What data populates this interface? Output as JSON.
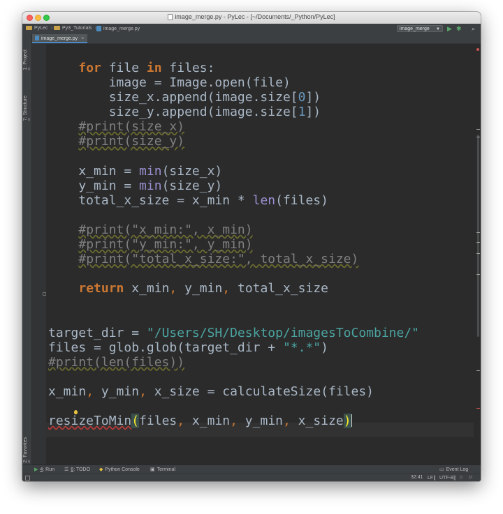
{
  "window": {
    "title": "image_merge.py - PyLec - [~/Documents/_Python/PyLec]"
  },
  "navbar": {
    "breadcrumbs": [
      "PyLec",
      "Py3_Tutorials",
      "image_merge.py"
    ],
    "run_config": "image_merge",
    "icons": [
      "run-icon",
      "debug-icon",
      "search-icon"
    ]
  },
  "tabs": [
    {
      "label": "image_merge.py",
      "active": true
    }
  ],
  "left_tool_windows": {
    "project": {
      "number": "1",
      "label": ": Project"
    },
    "structure": {
      "number": "7",
      "label": ": Structure"
    },
    "favorites": {
      "number": "2",
      "label": ": Favorites"
    }
  },
  "code_lines": [
    [
      {
        "t": "    "
      },
      {
        "t": "for",
        "c": "kw"
      },
      {
        "t": " file "
      },
      {
        "t": "in",
        "c": "kw"
      },
      {
        "t": " files:"
      }
    ],
    [
      {
        "t": "        image = Image.open(file)"
      }
    ],
    [
      {
        "t": "        size_x.append(image.size["
      },
      {
        "t": "0",
        "c": "num"
      },
      {
        "t": "])"
      }
    ],
    [
      {
        "t": "        size_y.append(image.size["
      },
      {
        "t": "1",
        "c": "num"
      },
      {
        "t": "])"
      }
    ],
    [
      {
        "t": "    "
      },
      {
        "t": "#print(size_x)",
        "c": "cm"
      }
    ],
    [
      {
        "t": "    "
      },
      {
        "t": "#print(size_y)",
        "c": "cm"
      }
    ],
    [],
    [
      {
        "t": "    x_min = "
      },
      {
        "t": "min",
        "c": "bi"
      },
      {
        "t": "(size_x)"
      }
    ],
    [
      {
        "t": "    y_min = "
      },
      {
        "t": "min",
        "c": "bi"
      },
      {
        "t": "(size_y)"
      }
    ],
    [
      {
        "t": "    total_x_size = x_min * "
      },
      {
        "t": "len",
        "c": "bi"
      },
      {
        "t": "(files)"
      }
    ],
    [],
    [
      {
        "t": "    "
      },
      {
        "t": "#print(\"x_min:\", x_min)",
        "c": "cm"
      }
    ],
    [
      {
        "t": "    "
      },
      {
        "t": "#print(\"y_min:\", y_min)",
        "c": "cm"
      }
    ],
    [
      {
        "t": "    "
      },
      {
        "t": "#print(\"total_x_size:\", total_x_size)",
        "c": "cm"
      }
    ],
    [],
    [
      {
        "t": "    "
      },
      {
        "t": "return",
        "c": "kw"
      },
      {
        "t": " x_min"
      },
      {
        "t": ",",
        "c": "comma"
      },
      {
        "t": " y_min"
      },
      {
        "t": ",",
        "c": "comma"
      },
      {
        "t": " total_x_size"
      }
    ],
    [],
    [],
    [
      {
        "t": "target_dir = "
      },
      {
        "t": "\"/Users/SH/Desktop/imagesToCombine/\"",
        "c": "str"
      }
    ],
    [
      {
        "t": "files = glob.glob(target_dir + "
      },
      {
        "t": "\"*.*\"",
        "c": "str"
      },
      {
        "t": ")"
      }
    ],
    [
      {
        "t": "#print(len(files))",
        "c": "cm"
      }
    ],
    [],
    [
      {
        "t": "x_min"
      },
      {
        "t": ",",
        "c": "comma"
      },
      {
        "t": " y_min"
      },
      {
        "t": ",",
        "c": "comma"
      },
      {
        "t": " x_size = calculateSize(files)"
      }
    ],
    [],
    [
      {
        "t": "resizeToMin",
        "c": "err"
      },
      {
        "t": "(",
        "c": "pmatch"
      },
      {
        "t": "files"
      },
      {
        "t": ",",
        "c": "comma"
      },
      {
        "t": " x_min"
      },
      {
        "t": ",",
        "c": "comma"
      },
      {
        "t": " y_min"
      },
      {
        "t": ",",
        "c": "comma"
      },
      {
        "t": " x_size"
      },
      {
        "t": ")",
        "c": "pmatch"
      },
      {
        "t": "",
        "c": "caret"
      }
    ]
  ],
  "bottom_tabs": [
    {
      "number": "4",
      "label": ": Run",
      "icon": "run-icon"
    },
    {
      "number": "6",
      "label": ": TODO",
      "icon": "todo-icon"
    },
    {
      "number": "",
      "label": "Python Console",
      "icon": "python-console-icon"
    },
    {
      "number": "",
      "label": "Terminal",
      "icon": "terminal-icon"
    }
  ],
  "event_log": "Event Log",
  "status": {
    "position": "32:41",
    "line_separator": "LF∥",
    "encoding": "UTF-8∥"
  }
}
